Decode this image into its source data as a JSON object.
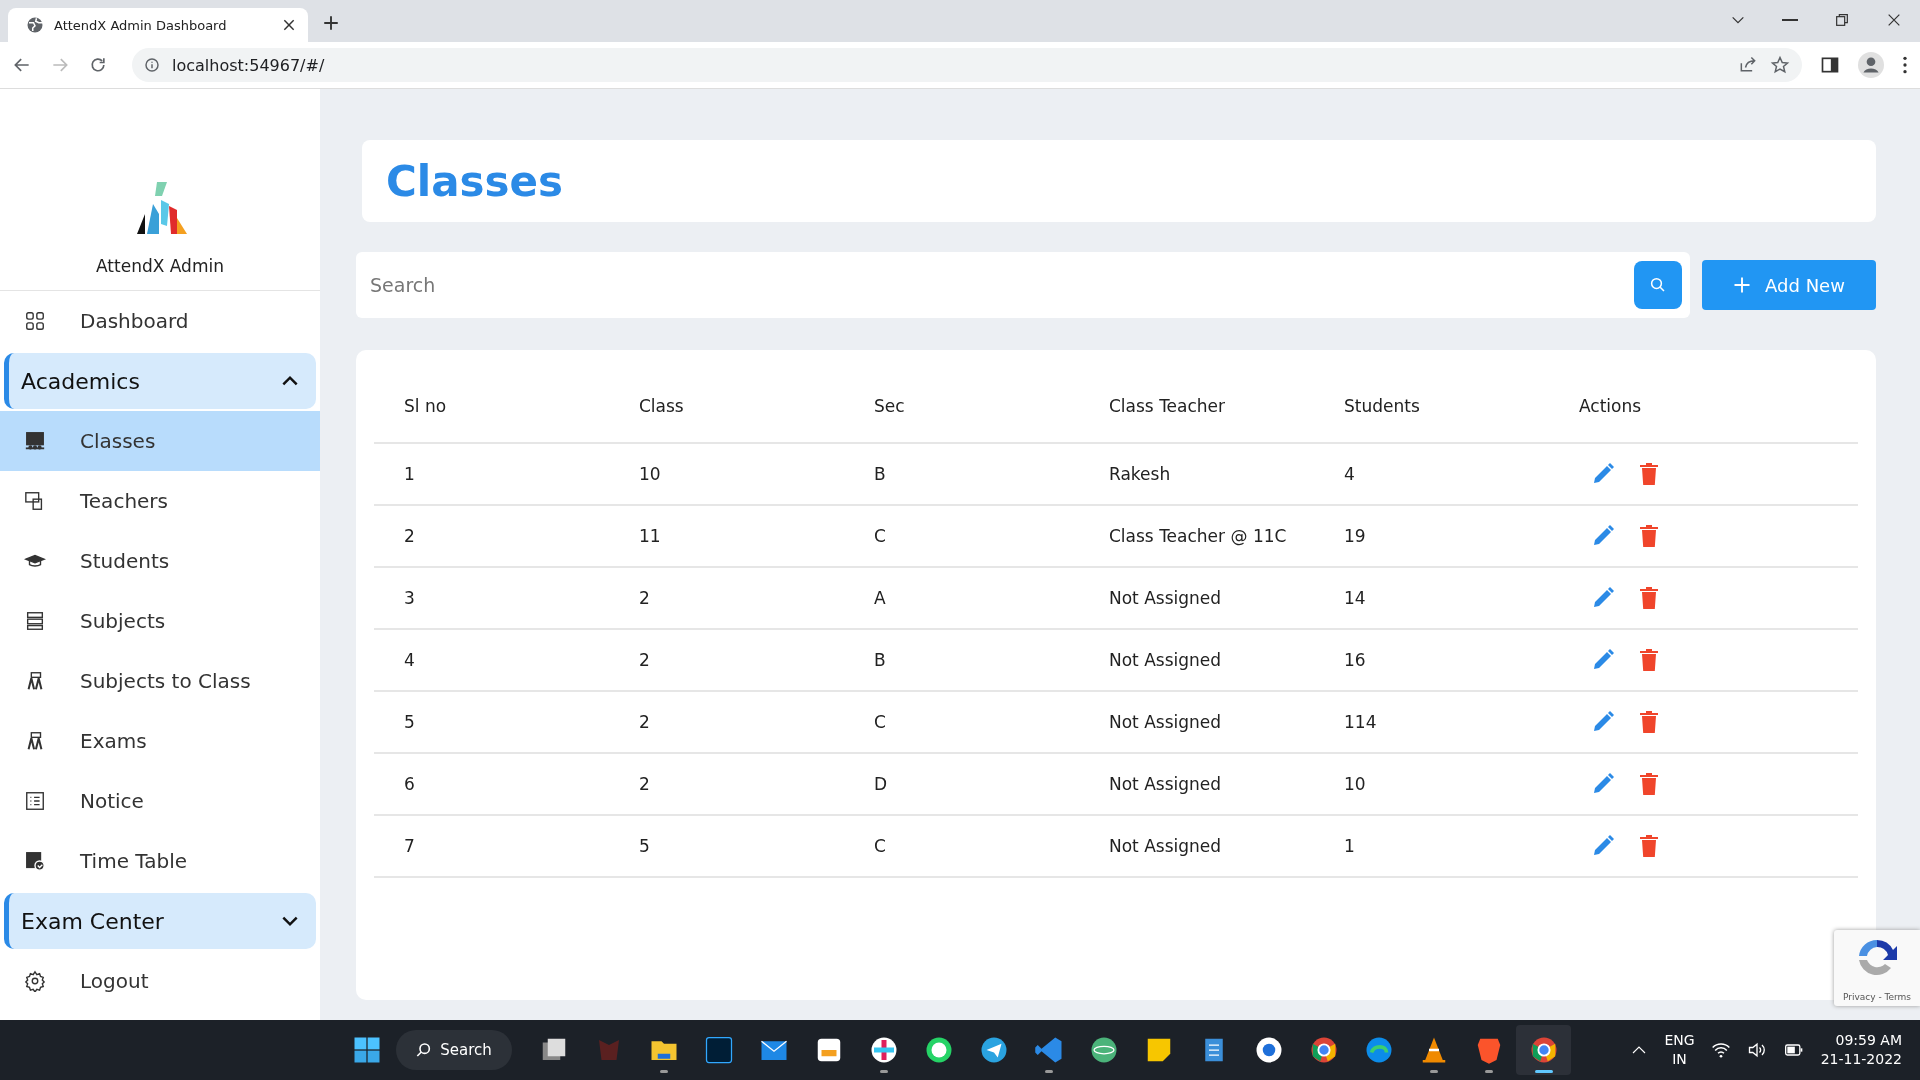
{
  "browser": {
    "tab_title": "AttendX Admin Dashboard",
    "url": "localhost:54967/#/"
  },
  "sidebar": {
    "brand": "AttendX Admin",
    "items": [
      {
        "kind": "link",
        "label": "Dashboard",
        "selected": false
      },
      {
        "kind": "group",
        "label": "Academics",
        "expanded": true,
        "children": [
          {
            "label": "Classes",
            "selected": true
          },
          {
            "label": "Teachers",
            "selected": false
          },
          {
            "label": "Students",
            "selected": false
          },
          {
            "label": "Subjects",
            "selected": false
          },
          {
            "label": "Subjects to Class",
            "selected": false
          },
          {
            "label": "Exams",
            "selected": false
          },
          {
            "label": "Notice",
            "selected": false
          },
          {
            "label": "Time Table",
            "selected": false
          }
        ]
      },
      {
        "kind": "group",
        "label": "Exam Center",
        "expanded": false
      },
      {
        "kind": "link",
        "label": "Logout",
        "selected": false
      }
    ]
  },
  "page": {
    "title": "Classes",
    "search": {
      "placeholder": "Search"
    },
    "add_button": "Add New",
    "table": {
      "columns": [
        "Sl no",
        "Class",
        "Sec",
        "Class Teacher",
        "Students",
        "Actions"
      ],
      "rows": [
        [
          "1",
          "10",
          "B",
          "Rakesh",
          "4"
        ],
        [
          "2",
          "11",
          "C",
          "Class Teacher @ 11C",
          "19"
        ],
        [
          "3",
          "2",
          "A",
          "Not Assigned",
          "14"
        ],
        [
          "4",
          "2",
          "B",
          "Not Assigned",
          "16"
        ],
        [
          "5",
          "2",
          "C",
          "Not Assigned",
          "114"
        ],
        [
          "6",
          "2",
          "D",
          "Not Assigned",
          "10"
        ],
        [
          "7",
          "5",
          "C",
          "Not Assigned",
          "1"
        ]
      ]
    }
  },
  "recaptcha": {
    "links": "Privacy - Terms"
  },
  "taskbar": {
    "search": "Search",
    "apps": [
      {
        "running": false,
        "selected": false
      },
      {
        "running": false,
        "selected": false
      },
      {
        "running": true,
        "selected": false
      },
      {
        "running": false,
        "selected": false
      },
      {
        "running": false,
        "selected": false
      },
      {
        "running": false,
        "selected": false
      },
      {
        "running": true,
        "selected": false
      },
      {
        "running": false,
        "selected": false
      },
      {
        "running": false,
        "selected": false
      },
      {
        "running": true,
        "selected": false
      },
      {
        "running": false,
        "selected": false
      },
      {
        "running": false,
        "selected": false
      },
      {
        "running": false,
        "selected": false
      },
      {
        "running": false,
        "selected": false
      },
      {
        "running": false,
        "selected": false
      },
      {
        "running": false,
        "selected": false
      },
      {
        "running": true,
        "selected": false
      },
      {
        "running": true,
        "selected": false
      },
      {
        "running": true,
        "selected": true
      }
    ],
    "language": "ENG",
    "region": "IN",
    "time": "09:59 AM",
    "date": "21-11-2022"
  }
}
